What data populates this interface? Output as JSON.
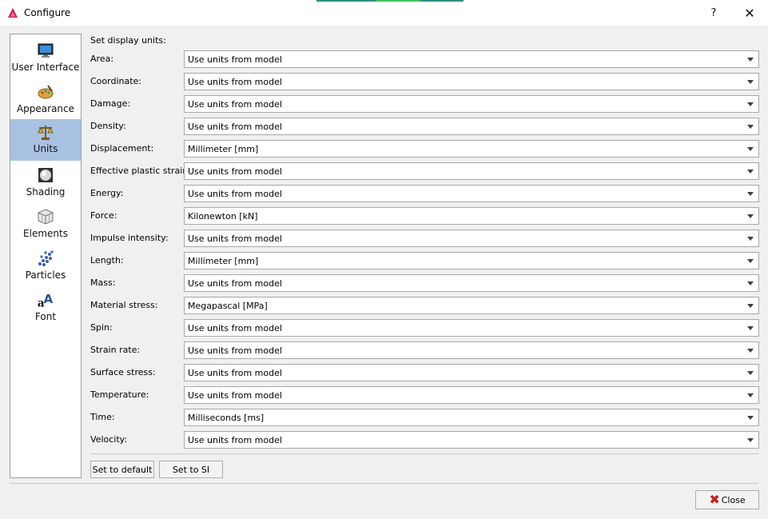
{
  "window": {
    "title": "Configure",
    "help_label": "?",
    "close_glyph": "✕"
  },
  "sidebar": {
    "items": [
      {
        "label": "User Interface",
        "icon": "monitor-icon",
        "selected": false
      },
      {
        "label": "Appearance",
        "icon": "palette-icon",
        "selected": false
      },
      {
        "label": "Units",
        "icon": "scales-icon",
        "selected": true
      },
      {
        "label": "Shading",
        "icon": "sphere-icon",
        "selected": false
      },
      {
        "label": "Elements",
        "icon": "cube-grid-icon",
        "selected": false
      },
      {
        "label": "Particles",
        "icon": "particles-icon",
        "selected": false
      },
      {
        "label": "Font",
        "icon": "font-icon",
        "selected": false
      }
    ]
  },
  "units": {
    "heading": "Set display units:",
    "rows": [
      {
        "label": "Area:",
        "value": "Use units from model"
      },
      {
        "label": "Coordinate:",
        "value": "Use units from model"
      },
      {
        "label": "Damage:",
        "value": "Use units from model"
      },
      {
        "label": "Density:",
        "value": "Use units from model"
      },
      {
        "label": "Displacement:",
        "value": "Millimeter [mm]"
      },
      {
        "label": "Effective plastic strain:",
        "value": "Use units from model"
      },
      {
        "label": "Energy:",
        "value": "Use units from model"
      },
      {
        "label": "Force:",
        "value": "Kilonewton [kN]"
      },
      {
        "label": "Impulse intensity:",
        "value": "Use units from model"
      },
      {
        "label": "Length:",
        "value": "Millimeter [mm]"
      },
      {
        "label": "Mass:",
        "value": "Use units from model"
      },
      {
        "label": "Material stress:",
        "value": "Megapascal [MPa]"
      },
      {
        "label": "Spin:",
        "value": "Use units from model"
      },
      {
        "label": "Strain rate:",
        "value": "Use units from model"
      },
      {
        "label": "Surface stress:",
        "value": "Use units from model"
      },
      {
        "label": "Temperature:",
        "value": "Use units from model"
      },
      {
        "label": "Time:",
        "value": "Milliseconds [ms]"
      },
      {
        "label": "Velocity:",
        "value": "Use units from model"
      }
    ],
    "set_default_label": "Set to default",
    "set_si_label": "Set to SI"
  },
  "footer": {
    "close_label": "Close"
  }
}
